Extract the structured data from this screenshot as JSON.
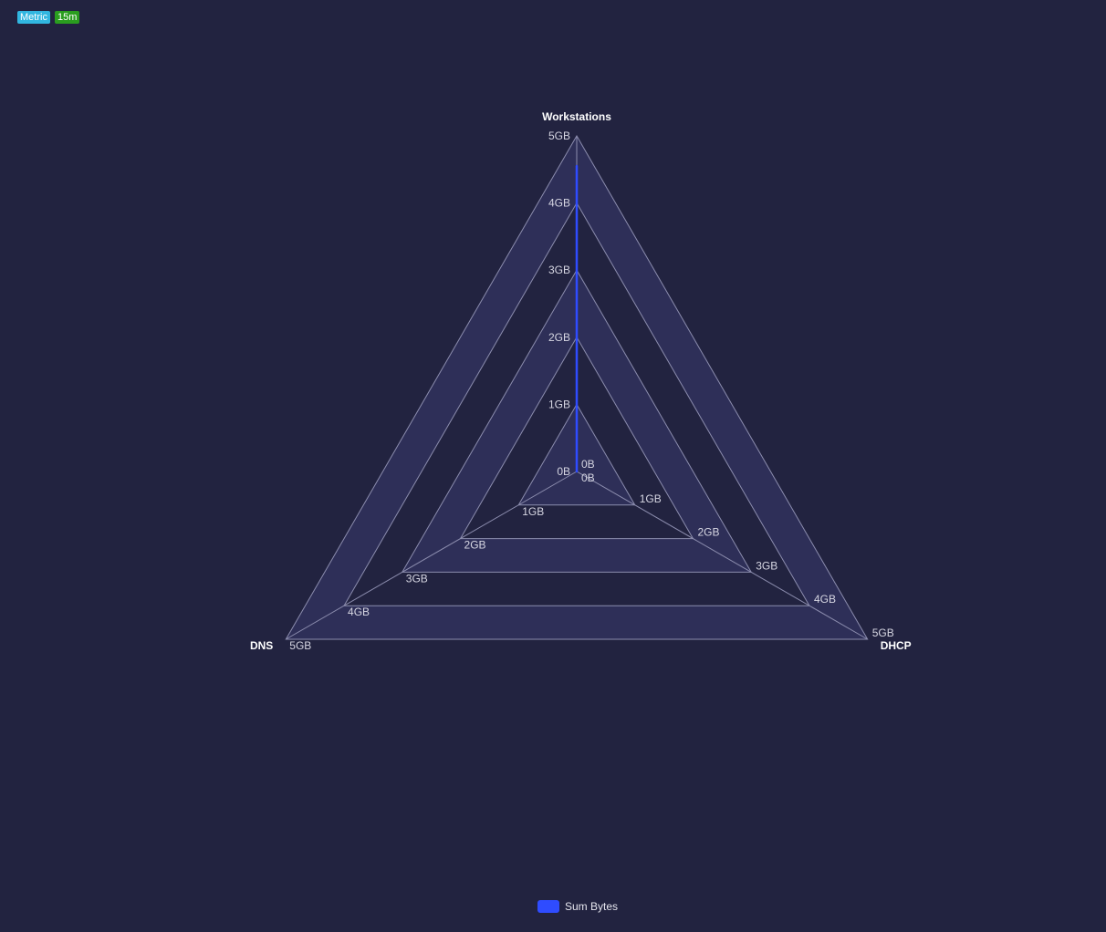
{
  "badges": {
    "metric": {
      "label": "Metric",
      "color": "#31b6e0"
    },
    "time_range": {
      "label": "15m",
      "color": "#2a9d1f"
    }
  },
  "colors": {
    "background": "#222340",
    "grid_line": "#8c8dae",
    "band_fill": "#2e2f58",
    "tick_label": "#d6d6e2",
    "axis_label": "#ffffff",
    "series": "#2f4cff"
  },
  "chart_data": {
    "type": "radar",
    "axes": [
      "Workstations",
      "DHCP",
      "DNS"
    ],
    "tick_values": [
      0,
      1,
      2,
      3,
      4,
      5
    ],
    "tick_labels": [
      "0B",
      "1GB",
      "2GB",
      "3GB",
      "4GB",
      "5GB"
    ],
    "range": [
      0,
      5
    ],
    "unit": "GB",
    "series": [
      {
        "name": "Sum Bytes",
        "values": [
          4.55,
          0,
          0
        ]
      }
    ],
    "legend_position": "bottom"
  },
  "legend": {
    "label": "Sum Bytes"
  }
}
